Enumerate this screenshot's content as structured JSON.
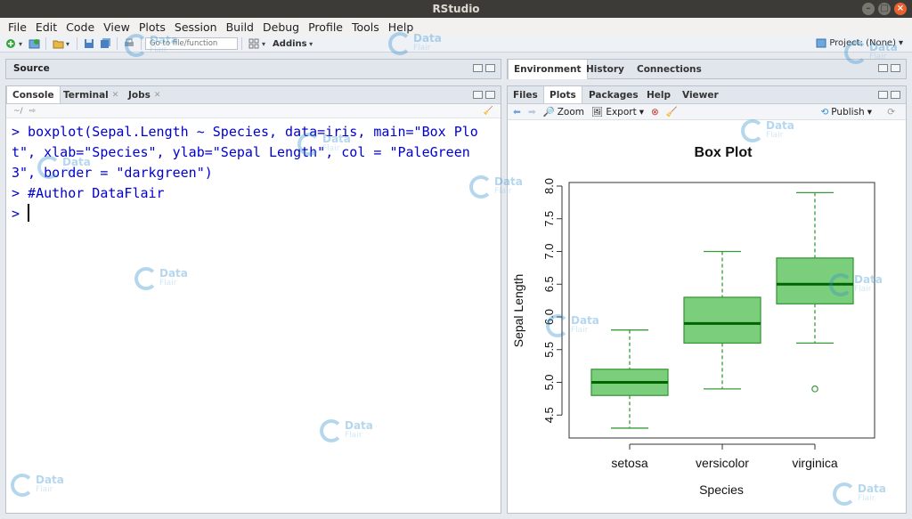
{
  "window": {
    "title": "RStudio"
  },
  "menu": [
    "File",
    "Edit",
    "Code",
    "View",
    "Plots",
    "Session",
    "Build",
    "Debug",
    "Profile",
    "Tools",
    "Help"
  ],
  "toolbar": {
    "goto_placeholder": "Go to file/function",
    "addins_label": "Addins",
    "project_label": "Project: (None)"
  },
  "source": {
    "title": "Source"
  },
  "console": {
    "tabs": [
      "Console",
      "Terminal",
      "Jobs"
    ],
    "path": "~/",
    "lines": [
      "> boxplot(Sepal.Length ~ Species, data=iris, main=\"Box Plo",
      "t\", xlab=\"Species\", ylab=\"Sepal Length\", col = \"PaleGreen",
      "3\", border = \"darkgreen\")",
      "> #Author DataFlair",
      "> "
    ]
  },
  "env": {
    "tabs": [
      "Environment",
      "History",
      "Connections"
    ]
  },
  "plots": {
    "tabs": [
      "Files",
      "Plots",
      "Packages",
      "Help",
      "Viewer"
    ],
    "zoom_label": "Zoom",
    "export_label": "Export",
    "publish_label": "Publish"
  },
  "watermark": {
    "brand": "Data",
    "sub": "Flair"
  },
  "colors": {
    "fill": "#7bce7b",
    "border": "#3a9a3a",
    "median": "#006400",
    "console_text": "#0000ce"
  },
  "chart_data": {
    "type": "boxplot",
    "title": "Box Plot",
    "xlabel": "Species",
    "ylabel": "Sepal Length",
    "categories": [
      "setosa",
      "versicolor",
      "virginica"
    ],
    "ylim": [
      4.3,
      8.0
    ],
    "yticks": [
      "4.5",
      "5.0",
      "5.5",
      "6.0",
      "6.5",
      "7.0",
      "7.5",
      "8.0"
    ],
    "boxes": [
      {
        "min": 4.3,
        "q1": 4.8,
        "median": 5.0,
        "q3": 5.2,
        "max": 5.8,
        "outliers": []
      },
      {
        "min": 4.9,
        "q1": 5.6,
        "median": 5.9,
        "q3": 6.3,
        "max": 7.0,
        "outliers": []
      },
      {
        "min": 5.6,
        "q1": 6.2,
        "median": 6.5,
        "q3": 6.9,
        "max": 7.9,
        "outliers": [
          4.9
        ]
      }
    ]
  }
}
